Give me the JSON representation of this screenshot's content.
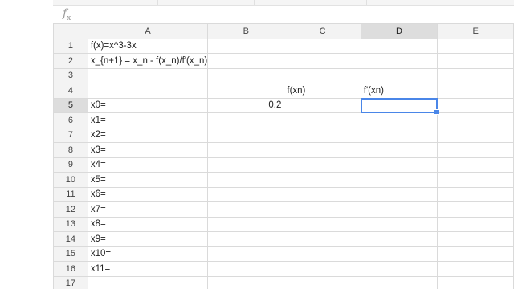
{
  "formula_bar": {
    "fx_symbol": "f",
    "fx_sub": "x",
    "value": ""
  },
  "columns": [
    "A",
    "B",
    "C",
    "D",
    "E"
  ],
  "selected_column": "D",
  "selected_row": "5",
  "rows": [
    {
      "num": "1",
      "cells": [
        "f(x)=x^3-3x",
        "",
        "",
        "",
        ""
      ]
    },
    {
      "num": "2",
      "cells": [
        "x_{n+1} = x_n - f(x_n)/f'(x_n)",
        "",
        "",
        "",
        ""
      ]
    },
    {
      "num": "3",
      "cells": [
        "",
        "",
        "",
        "",
        ""
      ]
    },
    {
      "num": "4",
      "cells": [
        "",
        "",
        "f(xn)",
        "f'(xn)",
        ""
      ]
    },
    {
      "num": "5",
      "cells": [
        "x0=",
        "0.2",
        "",
        "",
        ""
      ]
    },
    {
      "num": "6",
      "cells": [
        "x1=",
        "",
        "",
        "",
        ""
      ]
    },
    {
      "num": "7",
      "cells": [
        "x2=",
        "",
        "",
        "",
        ""
      ]
    },
    {
      "num": "8",
      "cells": [
        "x3=",
        "",
        "",
        "",
        ""
      ]
    },
    {
      "num": "9",
      "cells": [
        "x4=",
        "",
        "",
        "",
        ""
      ]
    },
    {
      "num": "10",
      "cells": [
        "x5=",
        "",
        "",
        "",
        ""
      ]
    },
    {
      "num": "11",
      "cells": [
        "x6=",
        "",
        "",
        "",
        ""
      ]
    },
    {
      "num": "12",
      "cells": [
        "x7=",
        "",
        "",
        "",
        ""
      ]
    },
    {
      "num": "13",
      "cells": [
        "x8=",
        "",
        "",
        "",
        ""
      ]
    },
    {
      "num": "14",
      "cells": [
        "x9=",
        "",
        "",
        "",
        ""
      ]
    },
    {
      "num": "15",
      "cells": [
        "x10=",
        "",
        "",
        "",
        ""
      ]
    },
    {
      "num": "16",
      "cells": [
        "x11=",
        "",
        "",
        "",
        ""
      ]
    },
    {
      "num": "17",
      "cells": [
        "",
        "",
        "",
        "",
        ""
      ]
    }
  ]
}
